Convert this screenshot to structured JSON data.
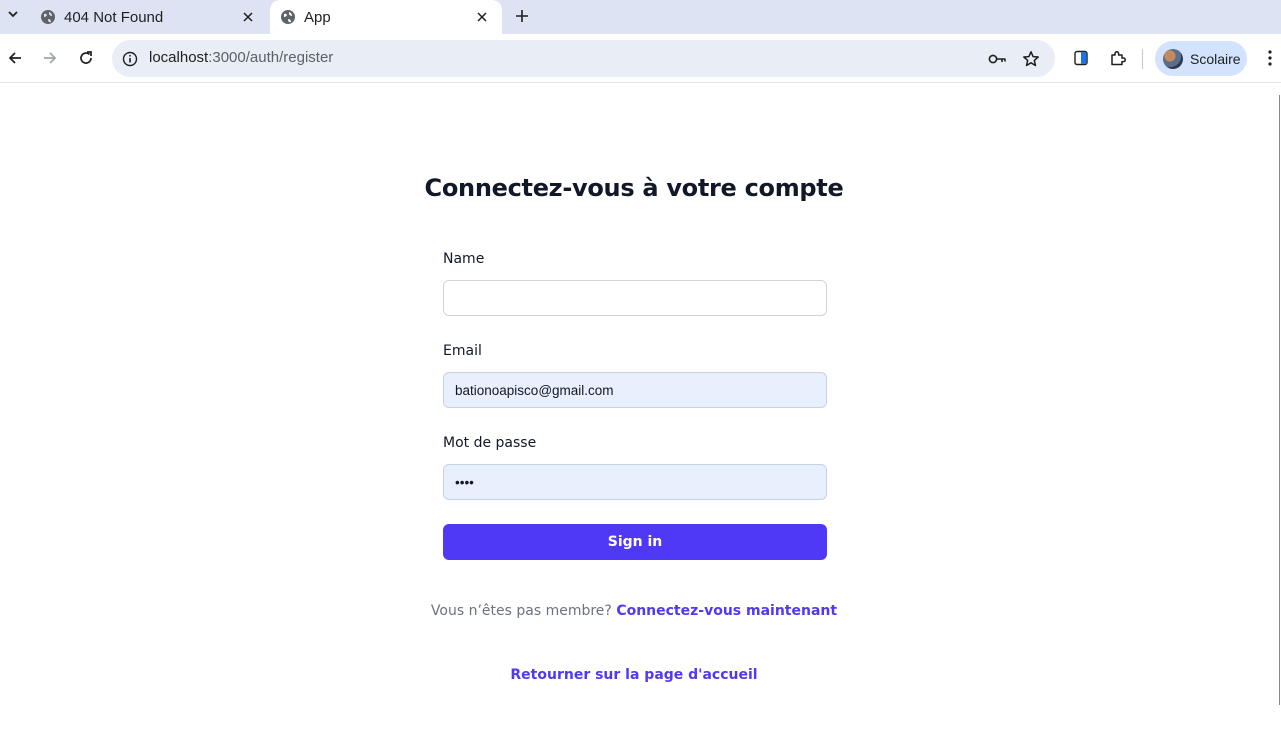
{
  "browser": {
    "tabs": [
      {
        "title": "404 Not Found",
        "active": false
      },
      {
        "title": "App",
        "active": true
      }
    ],
    "url_host": "localhost",
    "url_path": ":3000/auth/register",
    "profile_name": "Scolaire",
    "icons": [
      "tab-search-icon",
      "globe-icon",
      "close-icon",
      "plus-icon",
      "back-arrow-icon",
      "forward-arrow-icon",
      "reload-icon",
      "info-icon",
      "key-icon",
      "star-icon",
      "reading-mode-icon",
      "extensions-icon",
      "kebab-menu-icon"
    ]
  },
  "page": {
    "heading": "Connectez-vous à votre compte",
    "name_label": "Name",
    "name_value": "",
    "email_label": "Email",
    "email_value": "bationoapisco@gmail.com",
    "password_label": "Mot de passe",
    "password_value": "abcd",
    "signin_label": "Sign in",
    "not_member_text": "Vous n’êtes pas membre?",
    "signup_link": "Connectez-vous maintenant",
    "home_link": "Retourner sur la page d'accueil"
  },
  "colors": {
    "accent": "#4f39f6",
    "autofill_bg": "#e8f0fe",
    "heading": "#111827",
    "muted": "#6b7280"
  }
}
